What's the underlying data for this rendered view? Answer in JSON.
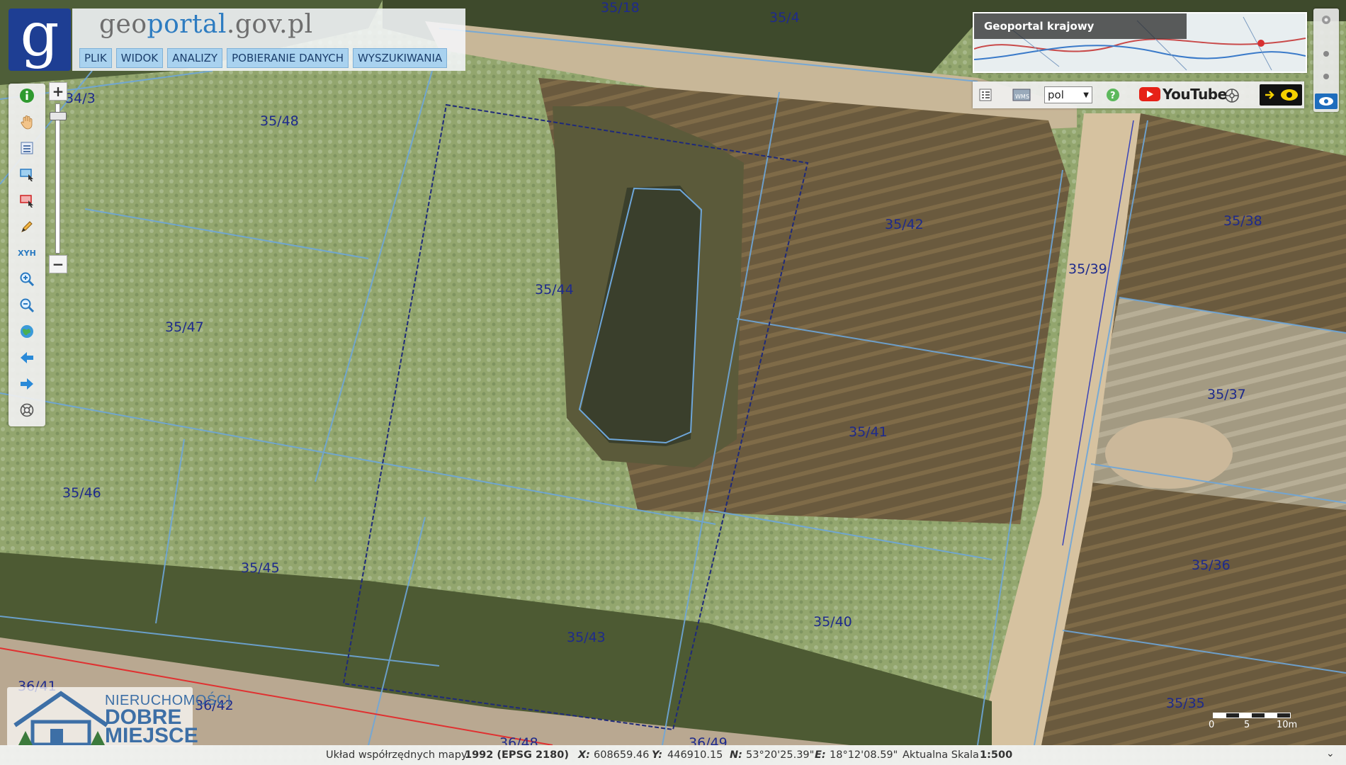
{
  "header": {
    "site_title_prefix": "geo",
    "site_title_accent": "portal",
    "site_title_suffix": ".gov.pl",
    "menu": [
      {
        "label": "PLIK"
      },
      {
        "label": "WIDOK"
      },
      {
        "label": "ANALIZY"
      },
      {
        "label": "POBIERANIE DANYCH"
      },
      {
        "label": "WYSZUKIWANIA"
      }
    ]
  },
  "toolbar": {
    "tools": [
      "info-icon",
      "hand-pan-icon",
      "layers-list-icon",
      "select-rect-icon",
      "select-rect-red-icon",
      "pencil-icon",
      "xyh-icon",
      "zoom-in-icon",
      "zoom-out-icon",
      "globe-icon",
      "back-arrow-icon",
      "forward-arrow-icon",
      "help-circle-icon"
    ],
    "xyh_label": "XYH"
  },
  "overview": {
    "title": "Geoportal krajowy"
  },
  "right_toolbar": {
    "language": "pol",
    "youtube_label": "YouTube"
  },
  "map": {
    "parcels": [
      {
        "id": "35/18"
      },
      {
        "id": "35/4"
      },
      {
        "id": "34/3"
      },
      {
        "id": "35/48"
      },
      {
        "id": "35/47"
      },
      {
        "id": "35/44"
      },
      {
        "id": "35/42"
      },
      {
        "id": "35/39"
      },
      {
        "id": "35/38"
      },
      {
        "id": "35/41"
      },
      {
        "id": "35/37"
      },
      {
        "id": "35/46"
      },
      {
        "id": "35/45"
      },
      {
        "id": "35/43"
      },
      {
        "id": "35/40"
      },
      {
        "id": "35/36"
      },
      {
        "id": "35/35"
      },
      {
        "id": "36/41"
      },
      {
        "id": "36/42"
      },
      {
        "id": "36/48"
      },
      {
        "id": "36/49"
      }
    ],
    "scale_labels": [
      "0",
      "5",
      "10m"
    ]
  },
  "watermark": {
    "line1": "NIERUCHOMOŚCI",
    "line2": "DOBRE",
    "line3": "MIEJSCE"
  },
  "status": {
    "crs_label": "Układ współrzędnych mapy",
    "crs_value": "1992 (EPSG 2180)",
    "x_label": "X:",
    "x_value": "608659.46",
    "y_label": "Y:",
    "y_value": "446910.15",
    "n_label": "N:",
    "n_value": "53°20'25.39\"",
    "e_label": "E:",
    "e_value": "18°12'08.59\"",
    "scale_label": "Aktualna Skala",
    "scale_value": "1:500"
  }
}
